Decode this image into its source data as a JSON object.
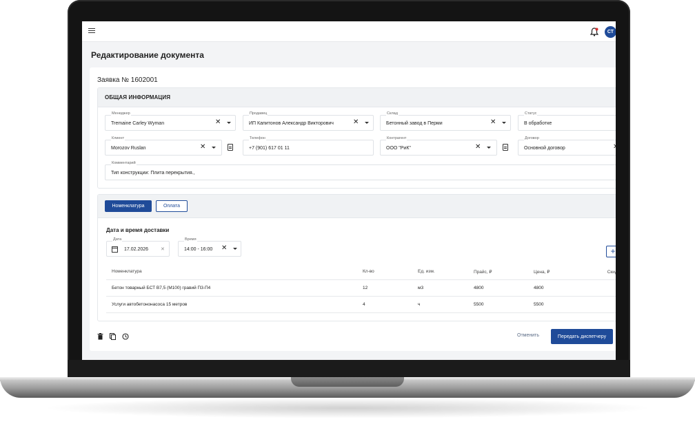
{
  "app": {
    "avatar_initials": "СТ"
  },
  "page": {
    "title": "Редактирование документа"
  },
  "request": {
    "title": "Заявка № 1602001"
  },
  "general": {
    "heading": "ОБЩАЯ ИНФОРМАЦИЯ",
    "manager": {
      "label": "Менеджер",
      "value": "Tremaine Carley Wyman"
    },
    "seller": {
      "label": "Продавец",
      "value": "ИП Капитонов Александр Викторович"
    },
    "warehouse": {
      "label": "Склад",
      "value": "Бетонный завод в Перми"
    },
    "status": {
      "label": "Статус",
      "value": "В обработке"
    },
    "client": {
      "label": "Клиент",
      "value": "Morozov Ruslan"
    },
    "phone": {
      "label": "Телефон",
      "value": "+7 (901) 617 01 11"
    },
    "counterparty": {
      "label": "Контрагент",
      "value": "ООО \"РиК\""
    },
    "contract": {
      "label": "Договор",
      "value": "Основной договор"
    },
    "comment": {
      "label": "Комментарий",
      "value": "Тип конструкции: Плита перекрытия.,"
    }
  },
  "tabs": [
    {
      "label": "Номенклатура"
    },
    {
      "label": "Оплата"
    }
  ],
  "delivery": {
    "title": "Дата и время доставки",
    "date": {
      "label": "Дата",
      "value": "17.02.2026"
    },
    "time": {
      "label": "Время",
      "value": "14:00 - 16:00"
    }
  },
  "items": {
    "columns": [
      "Номенклатура",
      "Кл-во",
      "Ед. изм.",
      "Прайс, ₽",
      "Цена, ₽",
      "Скидка, ₽"
    ],
    "rows": [
      [
        "Бетон товарный БСТ В7,5 (М100) гравий П3-П4",
        "12",
        "м3",
        "4800",
        "4800",
        ""
      ],
      [
        "Услуги автобетононасоса 15 метров",
        "4",
        "ч",
        "5500",
        "5500",
        ""
      ]
    ]
  },
  "footer": {
    "cancel_label": "Отменить",
    "submit_label": "Передать диспетчеру"
  },
  "colors": {
    "accent": "#1f4b99",
    "alert": "#d32f2f"
  }
}
